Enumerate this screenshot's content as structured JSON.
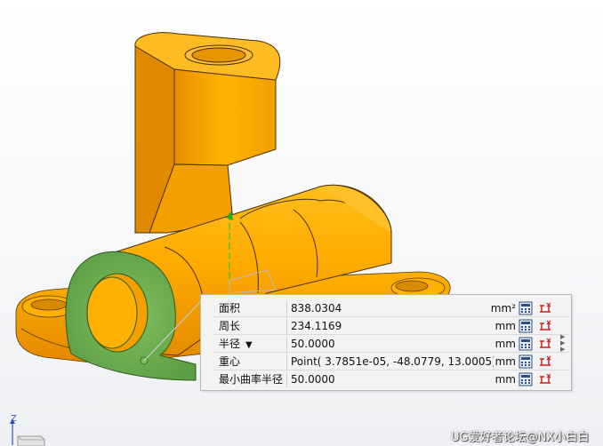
{
  "measure": {
    "rows": [
      {
        "label": "面积",
        "value": "838.0304",
        "unit": "mm²"
      },
      {
        "label": "周长",
        "value": "234.1169",
        "unit": "mm"
      },
      {
        "label": "半径",
        "dropdown": "▼",
        "value": "50.0000",
        "unit": "mm"
      },
      {
        "label": "重心",
        "value": "Point( 3.7851e-05, -48.0779, 13.0005)",
        "unit": "mm"
      },
      {
        "label": "最小曲率半径",
        "value": "50.0000",
        "unit": "mm"
      }
    ],
    "icons": [
      "calculator-icon",
      "export-icon"
    ]
  },
  "triad": {
    "axis_label": "Z"
  },
  "watermark": "UG爱好者论坛@NX小白白",
  "colors": {
    "part_orange": "#f5a000",
    "part_orange_dark": "#d98a00",
    "selected_face": "#6aa84f",
    "edge": "#3a2a00"
  }
}
